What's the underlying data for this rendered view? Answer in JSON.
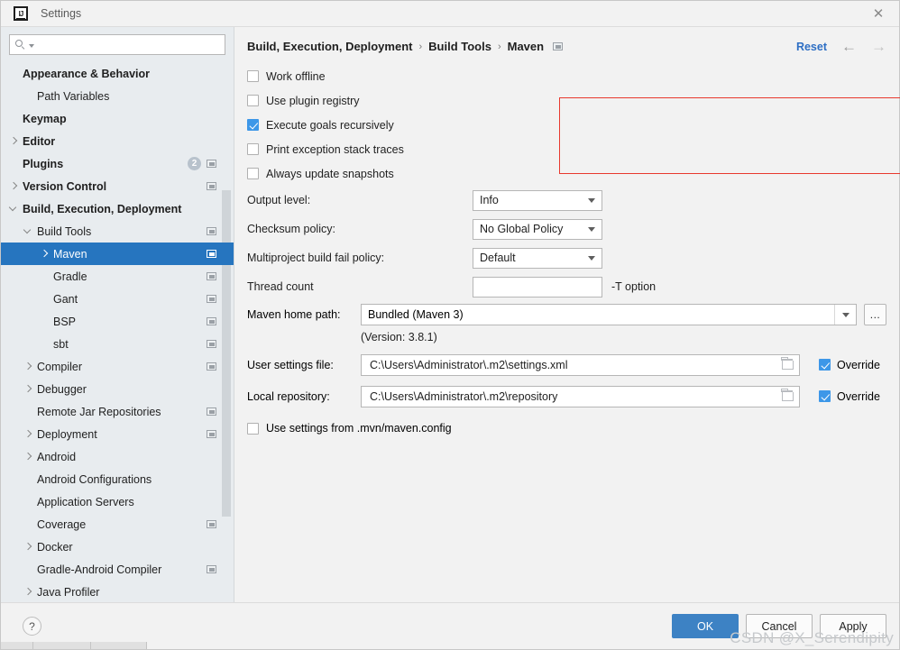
{
  "window": {
    "title": "Settings",
    "logo_text": "IJ",
    "close_label": "✕"
  },
  "sidebar": {
    "search": {
      "value": "",
      "placeholder": ""
    },
    "items": [
      {
        "label": "Appearance & Behavior",
        "indent": 0,
        "bold": true,
        "arrow": "none",
        "icon": false,
        "badge": null,
        "selected": false
      },
      {
        "label": "Path Variables",
        "indent": 1,
        "bold": false,
        "arrow": "none",
        "icon": false,
        "badge": null,
        "selected": false
      },
      {
        "label": "Keymap",
        "indent": 0,
        "bold": true,
        "arrow": "none",
        "icon": false,
        "badge": null,
        "selected": false
      },
      {
        "label": "Editor",
        "indent": 0,
        "bold": true,
        "arrow": "right",
        "icon": false,
        "badge": null,
        "selected": false
      },
      {
        "label": "Plugins",
        "indent": 0,
        "bold": true,
        "arrow": "none",
        "icon": true,
        "badge": "2",
        "selected": false
      },
      {
        "label": "Version Control",
        "indent": 0,
        "bold": true,
        "arrow": "right",
        "icon": true,
        "badge": null,
        "selected": false
      },
      {
        "label": "Build, Execution, Deployment",
        "indent": 0,
        "bold": true,
        "arrow": "down",
        "icon": false,
        "badge": null,
        "selected": false
      },
      {
        "label": "Build Tools",
        "indent": 1,
        "bold": false,
        "arrow": "down",
        "icon": true,
        "badge": null,
        "selected": false
      },
      {
        "label": "Maven",
        "indent": 2,
        "bold": false,
        "arrow": "right",
        "icon": true,
        "badge": null,
        "selected": true
      },
      {
        "label": "Gradle",
        "indent": 2,
        "bold": false,
        "arrow": "none",
        "icon": true,
        "badge": null,
        "selected": false
      },
      {
        "label": "Gant",
        "indent": 2,
        "bold": false,
        "arrow": "none",
        "icon": true,
        "badge": null,
        "selected": false
      },
      {
        "label": "BSP",
        "indent": 2,
        "bold": false,
        "arrow": "none",
        "icon": true,
        "badge": null,
        "selected": false
      },
      {
        "label": "sbt",
        "indent": 2,
        "bold": false,
        "arrow": "none",
        "icon": true,
        "badge": null,
        "selected": false
      },
      {
        "label": "Compiler",
        "indent": 1,
        "bold": false,
        "arrow": "right",
        "icon": true,
        "badge": null,
        "selected": false
      },
      {
        "label": "Debugger",
        "indent": 1,
        "bold": false,
        "arrow": "right",
        "icon": false,
        "badge": null,
        "selected": false
      },
      {
        "label": "Remote Jar Repositories",
        "indent": 1,
        "bold": false,
        "arrow": "none",
        "icon": true,
        "badge": null,
        "selected": false
      },
      {
        "label": "Deployment",
        "indent": 1,
        "bold": false,
        "arrow": "right",
        "icon": true,
        "badge": null,
        "selected": false
      },
      {
        "label": "Android",
        "indent": 1,
        "bold": false,
        "arrow": "right",
        "icon": false,
        "badge": null,
        "selected": false
      },
      {
        "label": "Android Configurations",
        "indent": 1,
        "bold": false,
        "arrow": "none",
        "icon": false,
        "badge": null,
        "selected": false
      },
      {
        "label": "Application Servers",
        "indent": 1,
        "bold": false,
        "arrow": "none",
        "icon": false,
        "badge": null,
        "selected": false
      },
      {
        "label": "Coverage",
        "indent": 1,
        "bold": false,
        "arrow": "none",
        "icon": true,
        "badge": null,
        "selected": false
      },
      {
        "label": "Docker",
        "indent": 1,
        "bold": false,
        "arrow": "right",
        "icon": false,
        "badge": null,
        "selected": false
      },
      {
        "label": "Gradle-Android Compiler",
        "indent": 1,
        "bold": false,
        "arrow": "none",
        "icon": true,
        "badge": null,
        "selected": false
      },
      {
        "label": "Java Profiler",
        "indent": 1,
        "bold": false,
        "arrow": "right",
        "icon": false,
        "badge": null,
        "selected": false
      }
    ]
  },
  "header": {
    "crumb1": "Build, Execution, Deployment",
    "crumb2": "Build Tools",
    "crumb3": "Maven",
    "separator": "›",
    "reset_label": "Reset",
    "back_arrow": "←",
    "forward_arrow": "→"
  },
  "main": {
    "checkboxes": [
      {
        "label": "Work offline",
        "checked": false
      },
      {
        "label": "Use plugin registry",
        "checked": false
      },
      {
        "label": "Execute goals recursively",
        "checked": true
      },
      {
        "label": "Print exception stack traces",
        "checked": false
      },
      {
        "label": "Always update snapshots",
        "checked": false
      }
    ],
    "output_level": {
      "label": "Output level:",
      "value": "Info"
    },
    "checksum_policy": {
      "label": "Checksum policy:",
      "value": "No Global Policy"
    },
    "multiproject_policy": {
      "label": "Multiproject build fail policy:",
      "value": "Default"
    },
    "thread_count": {
      "label": "Thread count",
      "value": "",
      "suffix": "-T option"
    },
    "maven_home": {
      "label": "Maven home path:",
      "value": "Bundled (Maven 3)",
      "browse_label": "...",
      "version_note": "(Version: 3.8.1)"
    },
    "user_settings": {
      "label": "User settings file:",
      "value": "C:\\Users\\Administrator\\.m2\\settings.xml",
      "override_label": "Override",
      "override_checked": true
    },
    "local_repository": {
      "label": "Local repository:",
      "value": "C:\\Users\\Administrator\\.m2\\repository",
      "override_label": "Override",
      "override_checked": true
    },
    "mvn_config": {
      "label": "Use settings from .mvn/maven.config",
      "checked": false
    },
    "highlight_color": "#e8392e"
  },
  "footer": {
    "help_label": "?",
    "ok_label": "OK",
    "cancel_label": "Cancel",
    "apply_label": "Apply",
    "watermark": "CSDN @X_Serendipity"
  },
  "colors": {
    "accent": "#2675bf",
    "primary_button": "#3d82c4",
    "checkbox_checked": "#3d97e8",
    "link": "#2e6fc4",
    "sidebar_bg": "#e8ecef"
  }
}
